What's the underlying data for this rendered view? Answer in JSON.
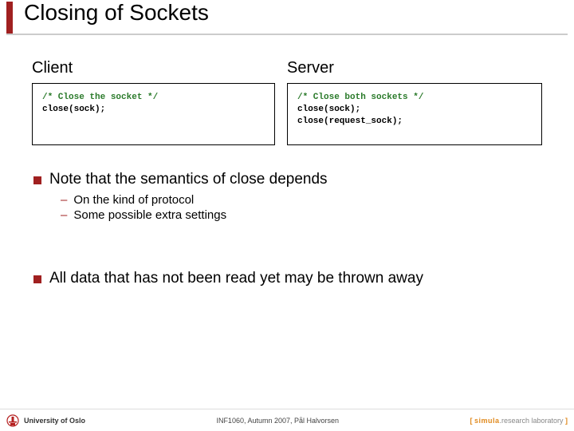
{
  "title": "Closing of Sockets",
  "columns": {
    "client_label": "Client",
    "server_label": "Server"
  },
  "code": {
    "client_comment": "/* Close the socket */",
    "client_line1": "close(sock);",
    "server_comment": "/* Close both sockets */",
    "server_line1": "close(sock);",
    "server_line2": "close(request_sock);"
  },
  "bullets": {
    "p1": "Note that the semantics of close depends",
    "p1_sub1": "On the kind of protocol",
    "p1_sub2": "Some possible extra settings",
    "p2": "All data that has not been read yet may be thrown away"
  },
  "footer": {
    "university": "University of Oslo",
    "course": "INF1060, Autumn 2007, Pål Halvorsen",
    "simula": "simula",
    "rlab": ".research laboratory"
  }
}
